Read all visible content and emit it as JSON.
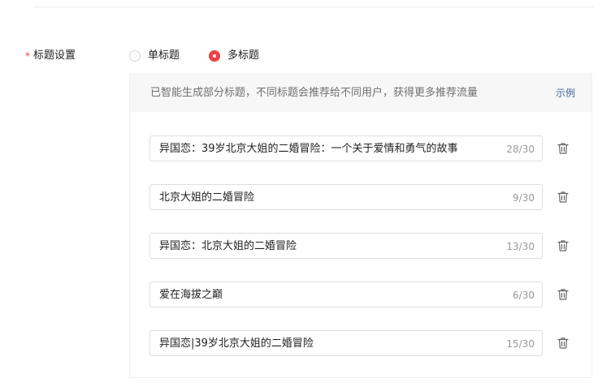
{
  "field": {
    "required_mark": "*",
    "label": "标题设置"
  },
  "mode_options": [
    {
      "label": "单标题",
      "selected": false
    },
    {
      "label": "多标题",
      "selected": true
    }
  ],
  "panel": {
    "hint": "已智能生成部分标题，不同标题会推荐给不同用户，获得更多推荐流量",
    "example_link": "示例"
  },
  "titles": [
    {
      "text": "异国恋：39岁北京大姐的二婚冒险：一个关于爱情和勇气的故事",
      "count": "28/30"
    },
    {
      "text": "北京大姐的二婚冒险",
      "count": "9/30"
    },
    {
      "text": "异国恋：北京大姐的二婚冒险",
      "count": "13/30"
    },
    {
      "text": "爱在海拔之巅",
      "count": "6/30"
    },
    {
      "text": "异国恋|39岁北京大姐的二婚冒险",
      "count": "15/30"
    }
  ],
  "icons": {
    "delete": "trash-icon",
    "radio": "radio-icon"
  },
  "colors": {
    "accent": "#f04142",
    "link": "#406599",
    "hint_text": "#707070",
    "counter": "#999999",
    "panel_header_bg": "#f7f7f7"
  }
}
